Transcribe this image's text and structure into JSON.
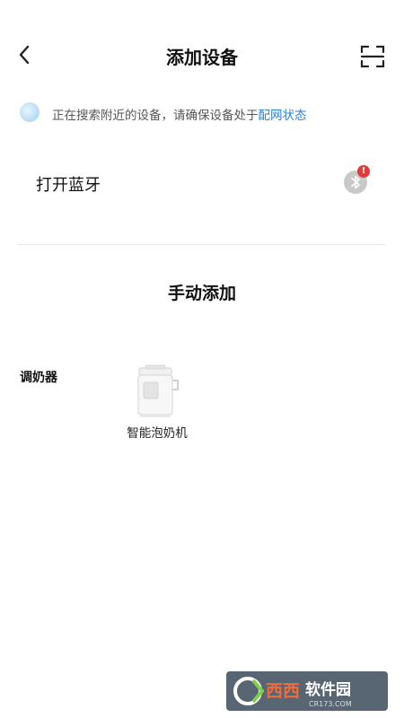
{
  "header": {
    "title": "添加设备",
    "back_icon": "back-arrow-icon",
    "scan_icon": "scan-icon"
  },
  "search_hint": {
    "text": "正在搜索附近的设备，请确保设备处于",
    "link": "配网状态",
    "link_color": "#2f7fd0"
  },
  "bluetooth": {
    "label": "打开蓝牙",
    "badge": "!",
    "badge_color": "#e23b3b"
  },
  "manual": {
    "title": "手动添加"
  },
  "category": {
    "label": "调奶器",
    "devices": [
      {
        "name": "智能泡奶机",
        "icon": "milk-machine-icon"
      }
    ]
  },
  "watermark": {
    "text_cn": "西西软件园",
    "text_en": "CR173.COM"
  }
}
